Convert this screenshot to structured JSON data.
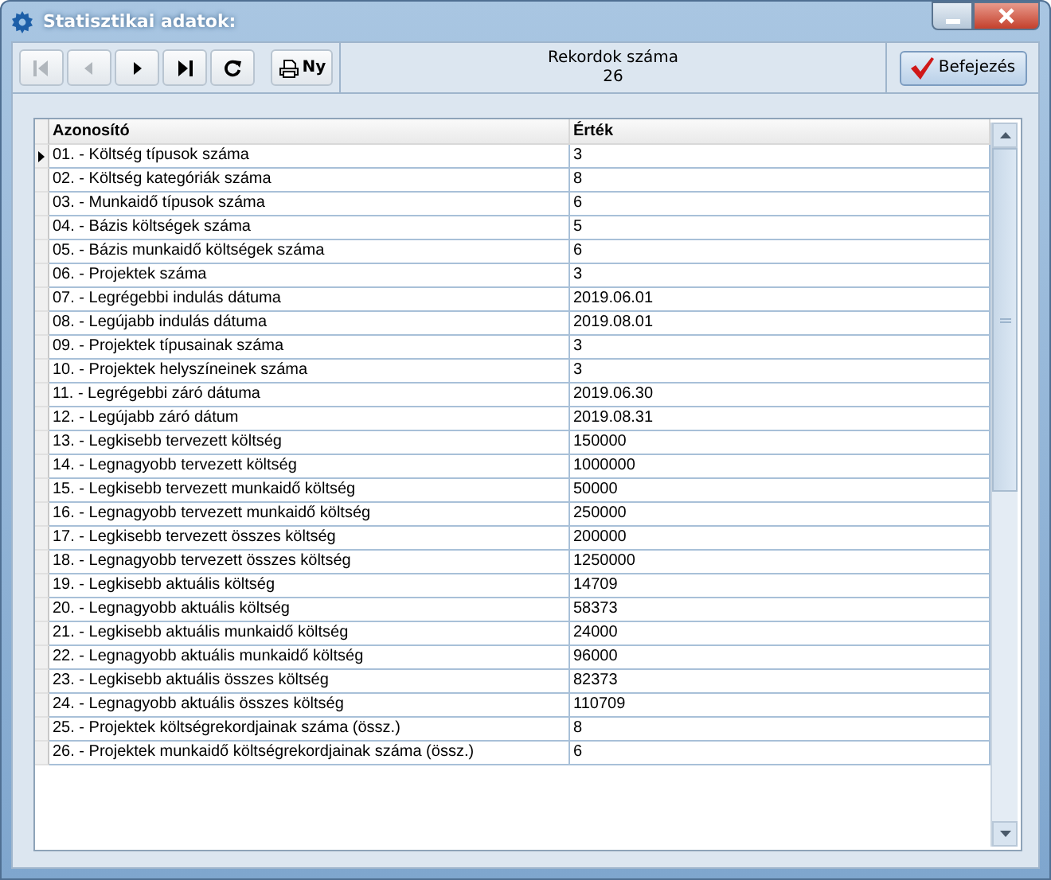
{
  "window": {
    "title": "Statisztikai adatok:"
  },
  "toolbar": {
    "buttons": [
      {
        "kind": "first",
        "disabled": true
      },
      {
        "kind": "prev",
        "disabled": true
      },
      {
        "kind": "next",
        "disabled": false
      },
      {
        "kind": "last",
        "disabled": false
      },
      {
        "kind": "refresh",
        "disabled": false
      },
      {
        "kind": "print",
        "label": "Ny",
        "disabled": false
      }
    ]
  },
  "record_count": {
    "label": "Rekordok száma",
    "value": "26"
  },
  "finish_button": {
    "label": "Befejezés"
  },
  "table": {
    "columns": [
      "Azonosító",
      "Érték"
    ],
    "rows": [
      {
        "id": "01. - Költség típusok száma",
        "value": "3",
        "selected": true
      },
      {
        "id": "02. - Költség kategóriák száma",
        "value": "8",
        "selected": false
      },
      {
        "id": "03. - Munkaidő típusok száma",
        "value": "6",
        "selected": false
      },
      {
        "id": "04. - Bázis költségek száma",
        "value": "5",
        "selected": false
      },
      {
        "id": "05. - Bázis munkaidő költségek száma",
        "value": "6",
        "selected": false
      },
      {
        "id": "06. - Projektek száma",
        "value": "3",
        "selected": false
      },
      {
        "id": "07. - Legrégebbi indulás dátuma",
        "value": "2019.06.01",
        "selected": false
      },
      {
        "id": "08. - Legújabb indulás dátuma",
        "value": "2019.08.01",
        "selected": false
      },
      {
        "id": "09. - Projektek típusainak száma",
        "value": "3",
        "selected": false
      },
      {
        "id": "10. - Projektek helyszíneinek száma",
        "value": "3",
        "selected": false
      },
      {
        "id": "11. - Legrégebbi záró dátuma",
        "value": "2019.06.30",
        "selected": false
      },
      {
        "id": "12. - Legújabb záró dátum",
        "value": "2019.08.31",
        "selected": false
      },
      {
        "id": "13. - Legkisebb tervezett költség",
        "value": "150000",
        "selected": false
      },
      {
        "id": "14. - Legnagyobb tervezett költség",
        "value": "1000000",
        "selected": false
      },
      {
        "id": "15. - Legkisebb tervezett munkaidő költség",
        "value": "50000",
        "selected": false
      },
      {
        "id": "16. - Legnagyobb tervezett munkaidő költség",
        "value": "250000",
        "selected": false
      },
      {
        "id": "17. - Legkisebb tervezett összes költség",
        "value": "200000",
        "selected": false
      },
      {
        "id": "18. - Legnagyobb tervezett összes költség",
        "value": "1250000",
        "selected": false
      },
      {
        "id": "19. - Legkisebb aktuális költség",
        "value": "14709",
        "selected": false
      },
      {
        "id": "20. - Legnagyobb aktuális költség",
        "value": "58373",
        "selected": false
      },
      {
        "id": "21. - Legkisebb aktuális munkaidő költség",
        "value": "24000",
        "selected": false
      },
      {
        "id": "22. - Legnagyobb aktuális munkaidő költség",
        "value": "96000",
        "selected": false
      },
      {
        "id": "23. - Legkisebb aktuális összes költség",
        "value": "82373",
        "selected": false
      },
      {
        "id": "24. - Legnagyobb aktuális összes költség",
        "value": "110709",
        "selected": false
      },
      {
        "id": "25. - Projektek költségrekordjainak száma (össz.)",
        "value": "8",
        "selected": false
      },
      {
        "id": "26. - Projektek munkaidő költségrekordjainak száma (össz.)",
        "value": "6",
        "selected": false
      }
    ]
  }
}
